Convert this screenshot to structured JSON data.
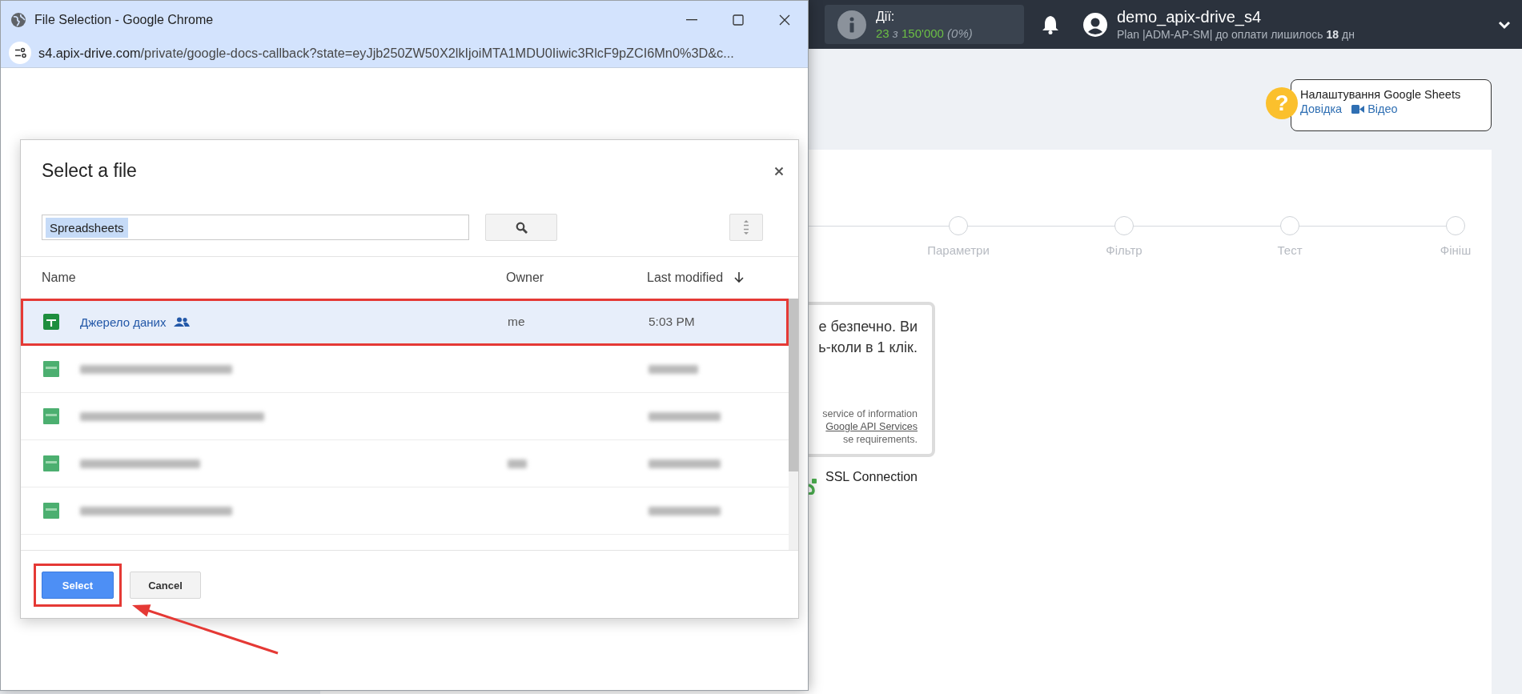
{
  "app": {
    "actions_label": "Дії:",
    "actions_used": "23",
    "actions_sep": "з",
    "actions_limit": "150'000",
    "actions_percent": "(0%)",
    "user_name": "demo_apix-drive_s4",
    "plan": "Plan |ADM-AP-SM| до оплати лишилось **18** дн",
    "help_icon": "?",
    "help_title": "Налаштування Google Sheets",
    "help_links": [
      {
        "label": "Довідка",
        "kind": "text"
      },
      {
        "label": "Відео",
        "kind": "video"
      }
    ],
    "steps": [
      {
        "label": "Параметри"
      },
      {
        "label": "Фільтр"
      },
      {
        "label": "Тест"
      },
      {
        "label": "Фініш"
      }
    ],
    "notice_lines": [
      "е безпечно. Ви",
      "ь-коли в 1 клік."
    ],
    "notice_small": [
      {
        "text": "service of information",
        "kind": "text"
      },
      {
        "text": "Google API Services",
        "kind": "link"
      },
      {
        "text": "se requirements.",
        "kind": "text"
      }
    ],
    "ssl": "SSL Connection"
  },
  "window": {
    "title": "File Selection - Google Chrome",
    "url_host": "s4.apix-drive.com",
    "url_path": "/private/google-docs-callback?state=eyJjb250ZW50X2lkIjoiMTA1MDU0Iiwic3RlcF9pZCI6Mn0%3D&c..."
  },
  "picker": {
    "title": "Select a file",
    "search_value": "Spreadsheets",
    "columns": [
      "Name",
      "Owner",
      "Last modified"
    ],
    "files": [
      {
        "kind": "file",
        "name": "Джерело даних",
        "shared": true,
        "owner": "me",
        "modified": "5:03 PM",
        "selected": true,
        "highlighted": true
      },
      {
        "kind": "blurred",
        "owner_blurred": false,
        "selected": false,
        "highlighted": false
      },
      {
        "kind": "blurred",
        "owner_blurred": false,
        "selected": false,
        "highlighted": false
      },
      {
        "kind": "blurred",
        "owner_blurred": true,
        "selected": false,
        "highlighted": false
      },
      {
        "kind": "blurred",
        "owner_blurred": false,
        "selected": false,
        "highlighted": false
      }
    ],
    "buttons": [
      {
        "label": "Select",
        "kind": "primary",
        "highlighted": true
      },
      {
        "label": "Cancel",
        "kind": "secondary",
        "highlighted": false
      }
    ]
  }
}
